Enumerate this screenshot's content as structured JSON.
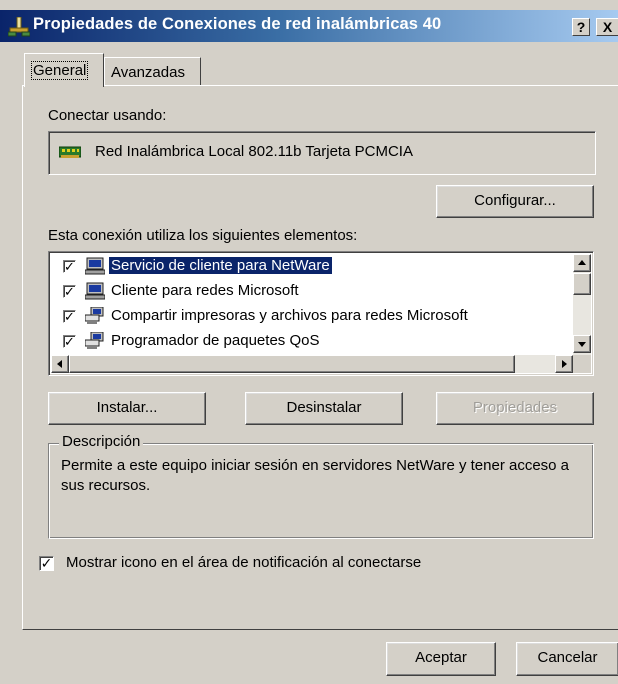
{
  "window": {
    "title": "Propiedades de Conexiones de red inalámbricas 40",
    "help_button": "?",
    "close_button": "X"
  },
  "tabs": [
    {
      "label": "General",
      "active": true
    },
    {
      "label": "Avanzadas",
      "active": false
    }
  ],
  "general": {
    "connect_using_label": "Conectar usando:",
    "adapter_name": "Red Inalámbrica Local 802.11b Tarjeta PCMCIA",
    "configure_button": "Configurar...",
    "components_label": "Esta conexión utiliza los siguientes elementos:",
    "components": [
      {
        "label": "Servicio de cliente para NetWare",
        "checked": true,
        "selected": true,
        "icon": "network-client-icon"
      },
      {
        "label": "Cliente para redes Microsoft",
        "checked": true,
        "selected": false,
        "icon": "network-client-icon"
      },
      {
        "label": "Compartir impresoras y archivos para redes Microsoft",
        "checked": true,
        "selected": false,
        "icon": "network-service-icon"
      },
      {
        "label": "Programador de paquetes QoS",
        "checked": true,
        "selected": false,
        "icon": "network-service-icon"
      }
    ],
    "install_button": "Instalar...",
    "uninstall_button": "Desinstalar",
    "properties_button": "Propiedades",
    "description_title": "Descripción",
    "description_text": "Permite a este equipo iniciar sesión en servidores NetWare y tener acceso a sus recursos.",
    "show_icon_label": "Mostrar icono en el área de notificación al conectarse",
    "show_icon_checked": true
  },
  "footer": {
    "ok_button": "Aceptar",
    "cancel_button": "Cancelar"
  }
}
